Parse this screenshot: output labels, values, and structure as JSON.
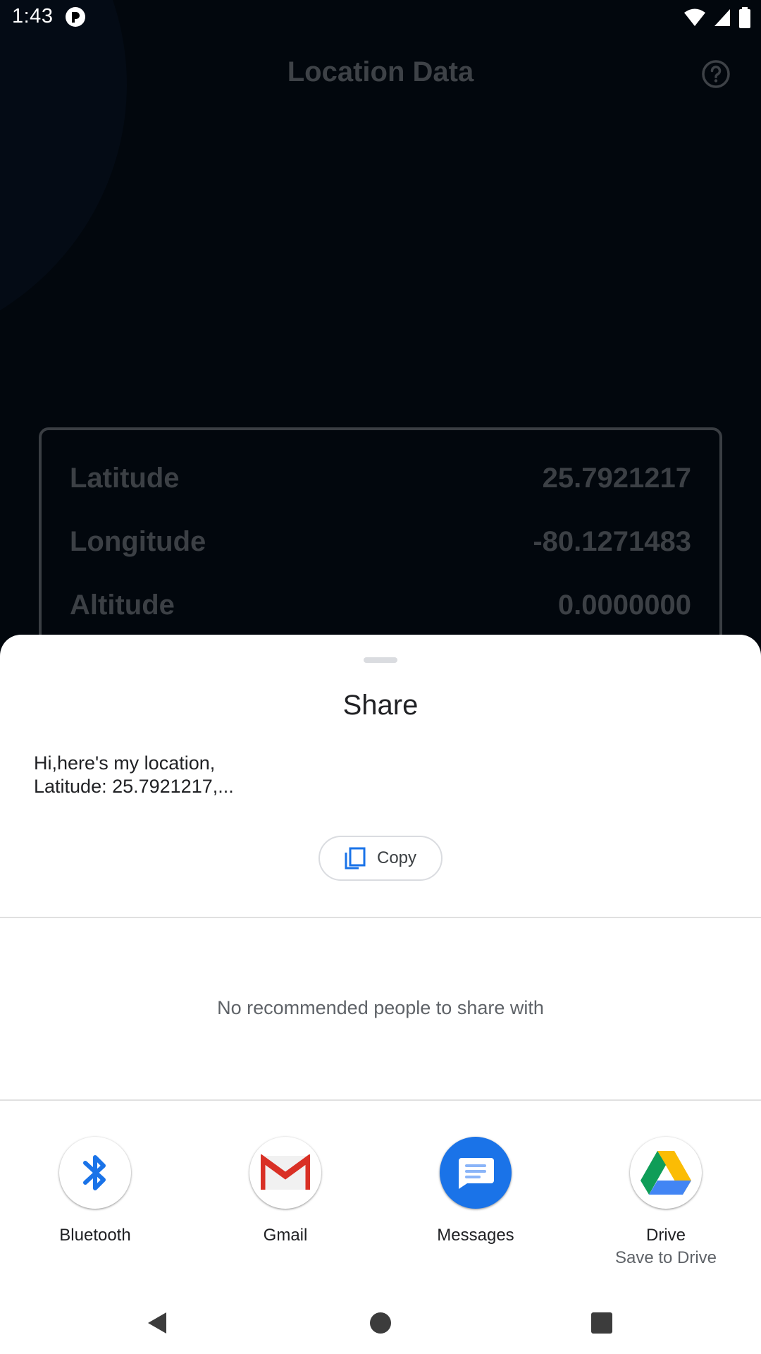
{
  "status_bar": {
    "time": "1:43",
    "icons": [
      "app-notification-icon",
      "wifi-icon",
      "signal-icon",
      "battery-icon"
    ]
  },
  "app": {
    "title": "Location Data",
    "help_icon": "help-circle-icon",
    "rows": [
      {
        "label": "Latitude",
        "value": "25.7921217"
      },
      {
        "label": "Longitude",
        "value": "-80.1271483"
      },
      {
        "label": "Altitude",
        "value": "0.0000000"
      }
    ]
  },
  "share_sheet": {
    "title": "Share",
    "text_preview": "Hi,here's my location,\nLatitude: 25.7921217,...",
    "copy_label": "Copy",
    "no_people_text": "No recommended people to share with",
    "targets": [
      {
        "label": "Bluetooth",
        "sublabel": "",
        "icon": "bluetooth-icon"
      },
      {
        "label": "Gmail",
        "sublabel": "",
        "icon": "gmail-icon"
      },
      {
        "label": "Messages",
        "sublabel": "",
        "icon": "messages-icon"
      },
      {
        "label": "Drive",
        "sublabel": "Save to Drive",
        "icon": "drive-icon"
      }
    ]
  },
  "nav_bar": {
    "buttons": [
      "back-icon",
      "home-icon",
      "recents-icon"
    ]
  },
  "colors": {
    "background": "#02070d",
    "sheet": "#ffffff",
    "accent_blue": "#1a73e8",
    "gmail_red": "#d93025"
  }
}
